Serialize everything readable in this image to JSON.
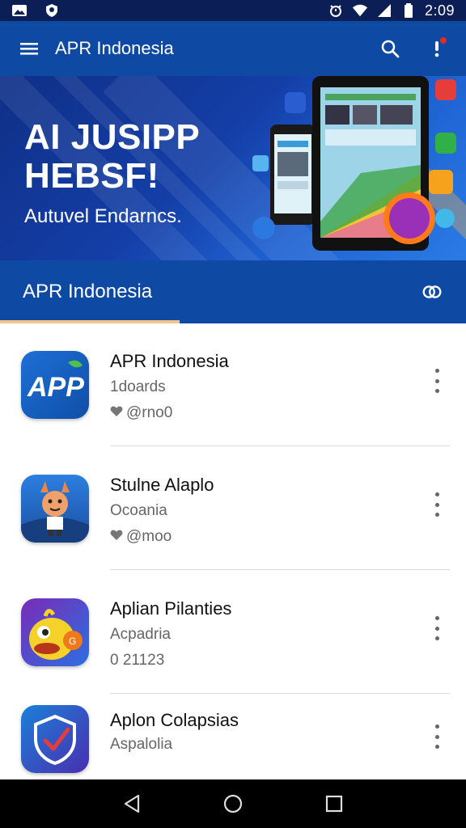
{
  "status_bar": {
    "time": "2:09",
    "left_icons": [
      "gallery-icon",
      "shield-icon"
    ],
    "right_icons": [
      "alarm-icon",
      "wifi-icon",
      "signal-icon",
      "battery-icon"
    ]
  },
  "app_bar": {
    "title": "APR Indonesia",
    "menu_icon": "menu-icon",
    "search_icon": "search-icon",
    "notification_icon": "notification-icon"
  },
  "banner": {
    "headline_line1": "AI JUSIPP",
    "headline_line2": "HEBSF!",
    "tagline": "Autuvel Endarncs."
  },
  "section": {
    "title": "APR Indonesia",
    "action_icon": "refresh-icon"
  },
  "apps": [
    {
      "name": "APR Indonesia",
      "subtitle": "1doards",
      "meta": "@rno0",
      "has_heart": true,
      "icon": "apr-logo-icon",
      "icon_colors": [
        "#0f4fa8",
        "#1e6fd6"
      ]
    },
    {
      "name": "Stulne Alaplo",
      "subtitle": "Ocoania",
      "meta": "@moo",
      "has_heart": true,
      "icon": "cartoon-character-icon",
      "icon_colors": [
        "#1b5fb8",
        "#2c7fe0"
      ]
    },
    {
      "name": "Aplian Pilanties",
      "subtitle": "Acpadria",
      "meta": "0 21123",
      "has_heart": false,
      "icon": "yellow-bird-icon",
      "icon_colors": [
        "#7a2bb8",
        "#2c6fe0"
      ]
    },
    {
      "name": "Aplon Colapsias",
      "subtitle": "Aspalolia",
      "meta": "",
      "has_heart": false,
      "icon": "shield-check-icon",
      "icon_colors": [
        "#1b7fd8",
        "#4a2fb0"
      ]
    }
  ],
  "colors": {
    "primary": "#0e4aa3",
    "status_bar": "#0b1f56",
    "accent_underline": "#f3c58a"
  },
  "nav": {
    "back_icon": "back-icon",
    "home_icon": "home-icon",
    "recents_icon": "recents-icon"
  }
}
